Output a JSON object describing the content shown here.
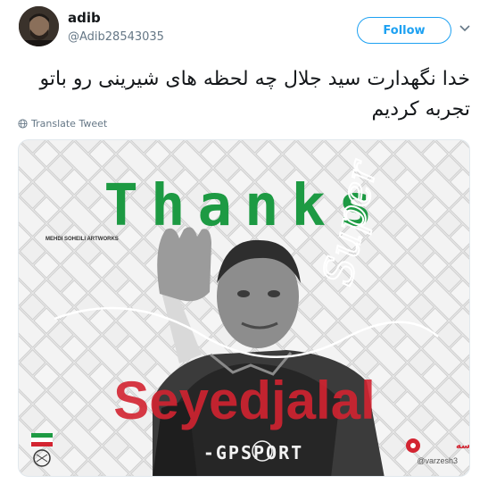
{
  "user": {
    "name": "adib",
    "handle": "@Adib28543035"
  },
  "actions": {
    "follow_label": "Follow",
    "menu_icon": "chevron-down-icon"
  },
  "tweet": {
    "text": "خدا نگهدارت سید جلال چه لحظه های شیرینی رو باتو تجربه کردیم",
    "translate_label": "Translate Tweet",
    "translate_icon": "globe-icon"
  },
  "media": {
    "headline": "Thanks",
    "overlay_script": "Super",
    "player_name": "Seyedjalal",
    "credit": "MEHDI SOHEILI ARTWORKS",
    "shirt_sponsor": "-GPSPORT",
    "watermark_brand": "ورزش سه",
    "watermark_handle": "@varzesh3",
    "colors": {
      "green": "#1d9a43",
      "red": "#d32431",
      "twitter_blue": "#1da1f2"
    }
  }
}
